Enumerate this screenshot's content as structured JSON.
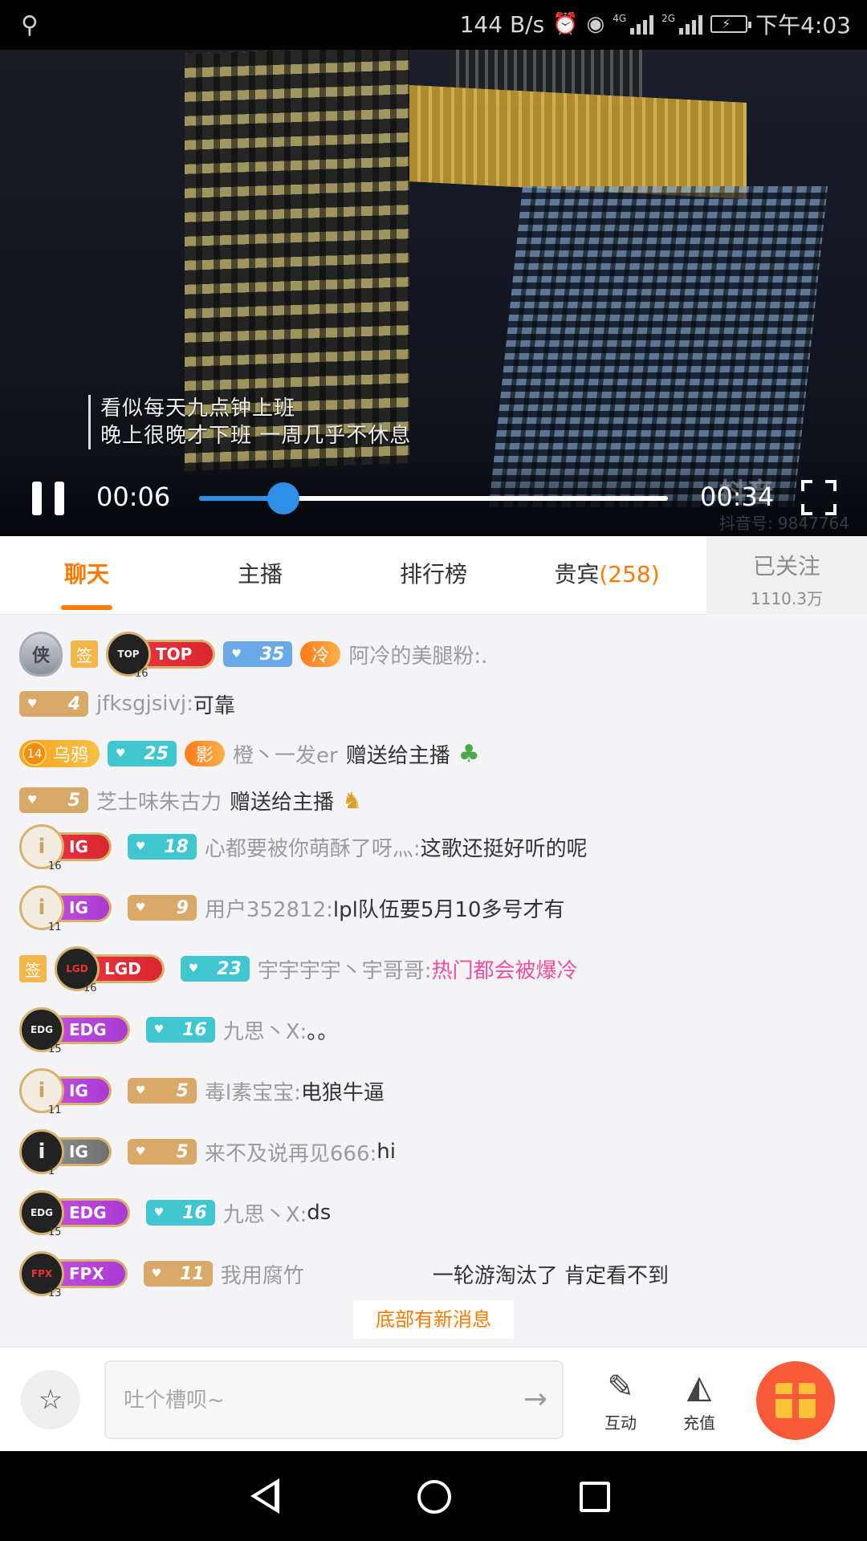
{
  "status_bar": {
    "net_speed": "144 B/s",
    "network_1": "4G",
    "network_2": "2G",
    "time": "下午4:03",
    "icons": [
      "usb-icon",
      "alarm-icon",
      "eye-icon",
      "signal-icon",
      "battery-icon"
    ]
  },
  "video": {
    "subtitle_line1": "看似每天九点钟上班",
    "subtitle_line2": "晚上很晚才下班 一周几乎不休息",
    "watermark": "抖音",
    "watermark_id": "抖音号: 9847764",
    "current_time": "00:06",
    "total_time": "00:34",
    "progress": 0.18
  },
  "tabs": {
    "chat": "聊天",
    "streamer": "主播",
    "ranking": "排行榜",
    "vip": "贵宾",
    "vip_count": "(258)",
    "follow_label": "已关注",
    "follow_count": "1110.3万"
  },
  "chat": {
    "m1": {
      "shield": "侠",
      "sign": "签",
      "team_plate": "TOP",
      "team_sub": "16",
      "level": "35",
      "fire_tag": "冷",
      "user": "阿冷的美腿粉:.",
      "text": ""
    },
    "m2": {
      "level": "4",
      "user": "jfksgjsivj:",
      "text": "可靠"
    },
    "m3": {
      "crow_num": "14",
      "crow_label": "乌鸦",
      "level": "25",
      "fire_tag": "影",
      "user": "橙丶一发er",
      "text": "赠送给主播"
    },
    "m4": {
      "level": "5",
      "user": "芝士味朱古力",
      "text": "赠送给主播"
    },
    "m5": {
      "team_plate": "IG",
      "team_sub": "16",
      "level": "18",
      "user": "心都要被你萌酥了呀灬:",
      "text": "这歌还挺好听的呢"
    },
    "m6": {
      "team_plate": "IG",
      "team_sub": "11",
      "level": "9",
      "user": "用户352812:",
      "text": "lpl队伍要5月10多号才有"
    },
    "m7": {
      "sign": "签",
      "team_plate": "LGD",
      "team_sub": "16",
      "level": "23",
      "user": "宇宇宇宇丶宇哥哥:",
      "text": "热门都会被爆冷"
    },
    "m8": {
      "team_logo": "EDG",
      "team_plate": "EDG",
      "team_sub": "15",
      "level": "16",
      "user": "九思丶X:",
      "text": "。。"
    },
    "m9": {
      "team_plate": "IG",
      "team_sub": "11",
      "level": "5",
      "user": "毒l素宝宝:",
      "text": "电狼牛逼"
    },
    "m10": {
      "team_plate": "IG",
      "team_sub": "1",
      "level": "5",
      "user": "来不及说再见666:",
      "text": "hi"
    },
    "m11": {
      "team_logo": "EDG",
      "team_plate": "EDG",
      "team_sub": "15",
      "level": "16",
      "user": "九思丶X:",
      "text": "ds"
    },
    "m12": {
      "team_logo": "FPX",
      "team_plate": "FPX",
      "team_sub": "13",
      "level": "11",
      "user": "我用腐竹",
      "text": "一轮游淘汰了 肯定看不到"
    }
  },
  "new_messages": "底部有新消息",
  "input": {
    "placeholder": "吐个槽呗~",
    "interact_label": "互动",
    "recharge_label": "充值"
  },
  "colors": {
    "accent": "#ff7a00",
    "progress": "#2e8fe6",
    "gift_button": "#f85a3a"
  }
}
